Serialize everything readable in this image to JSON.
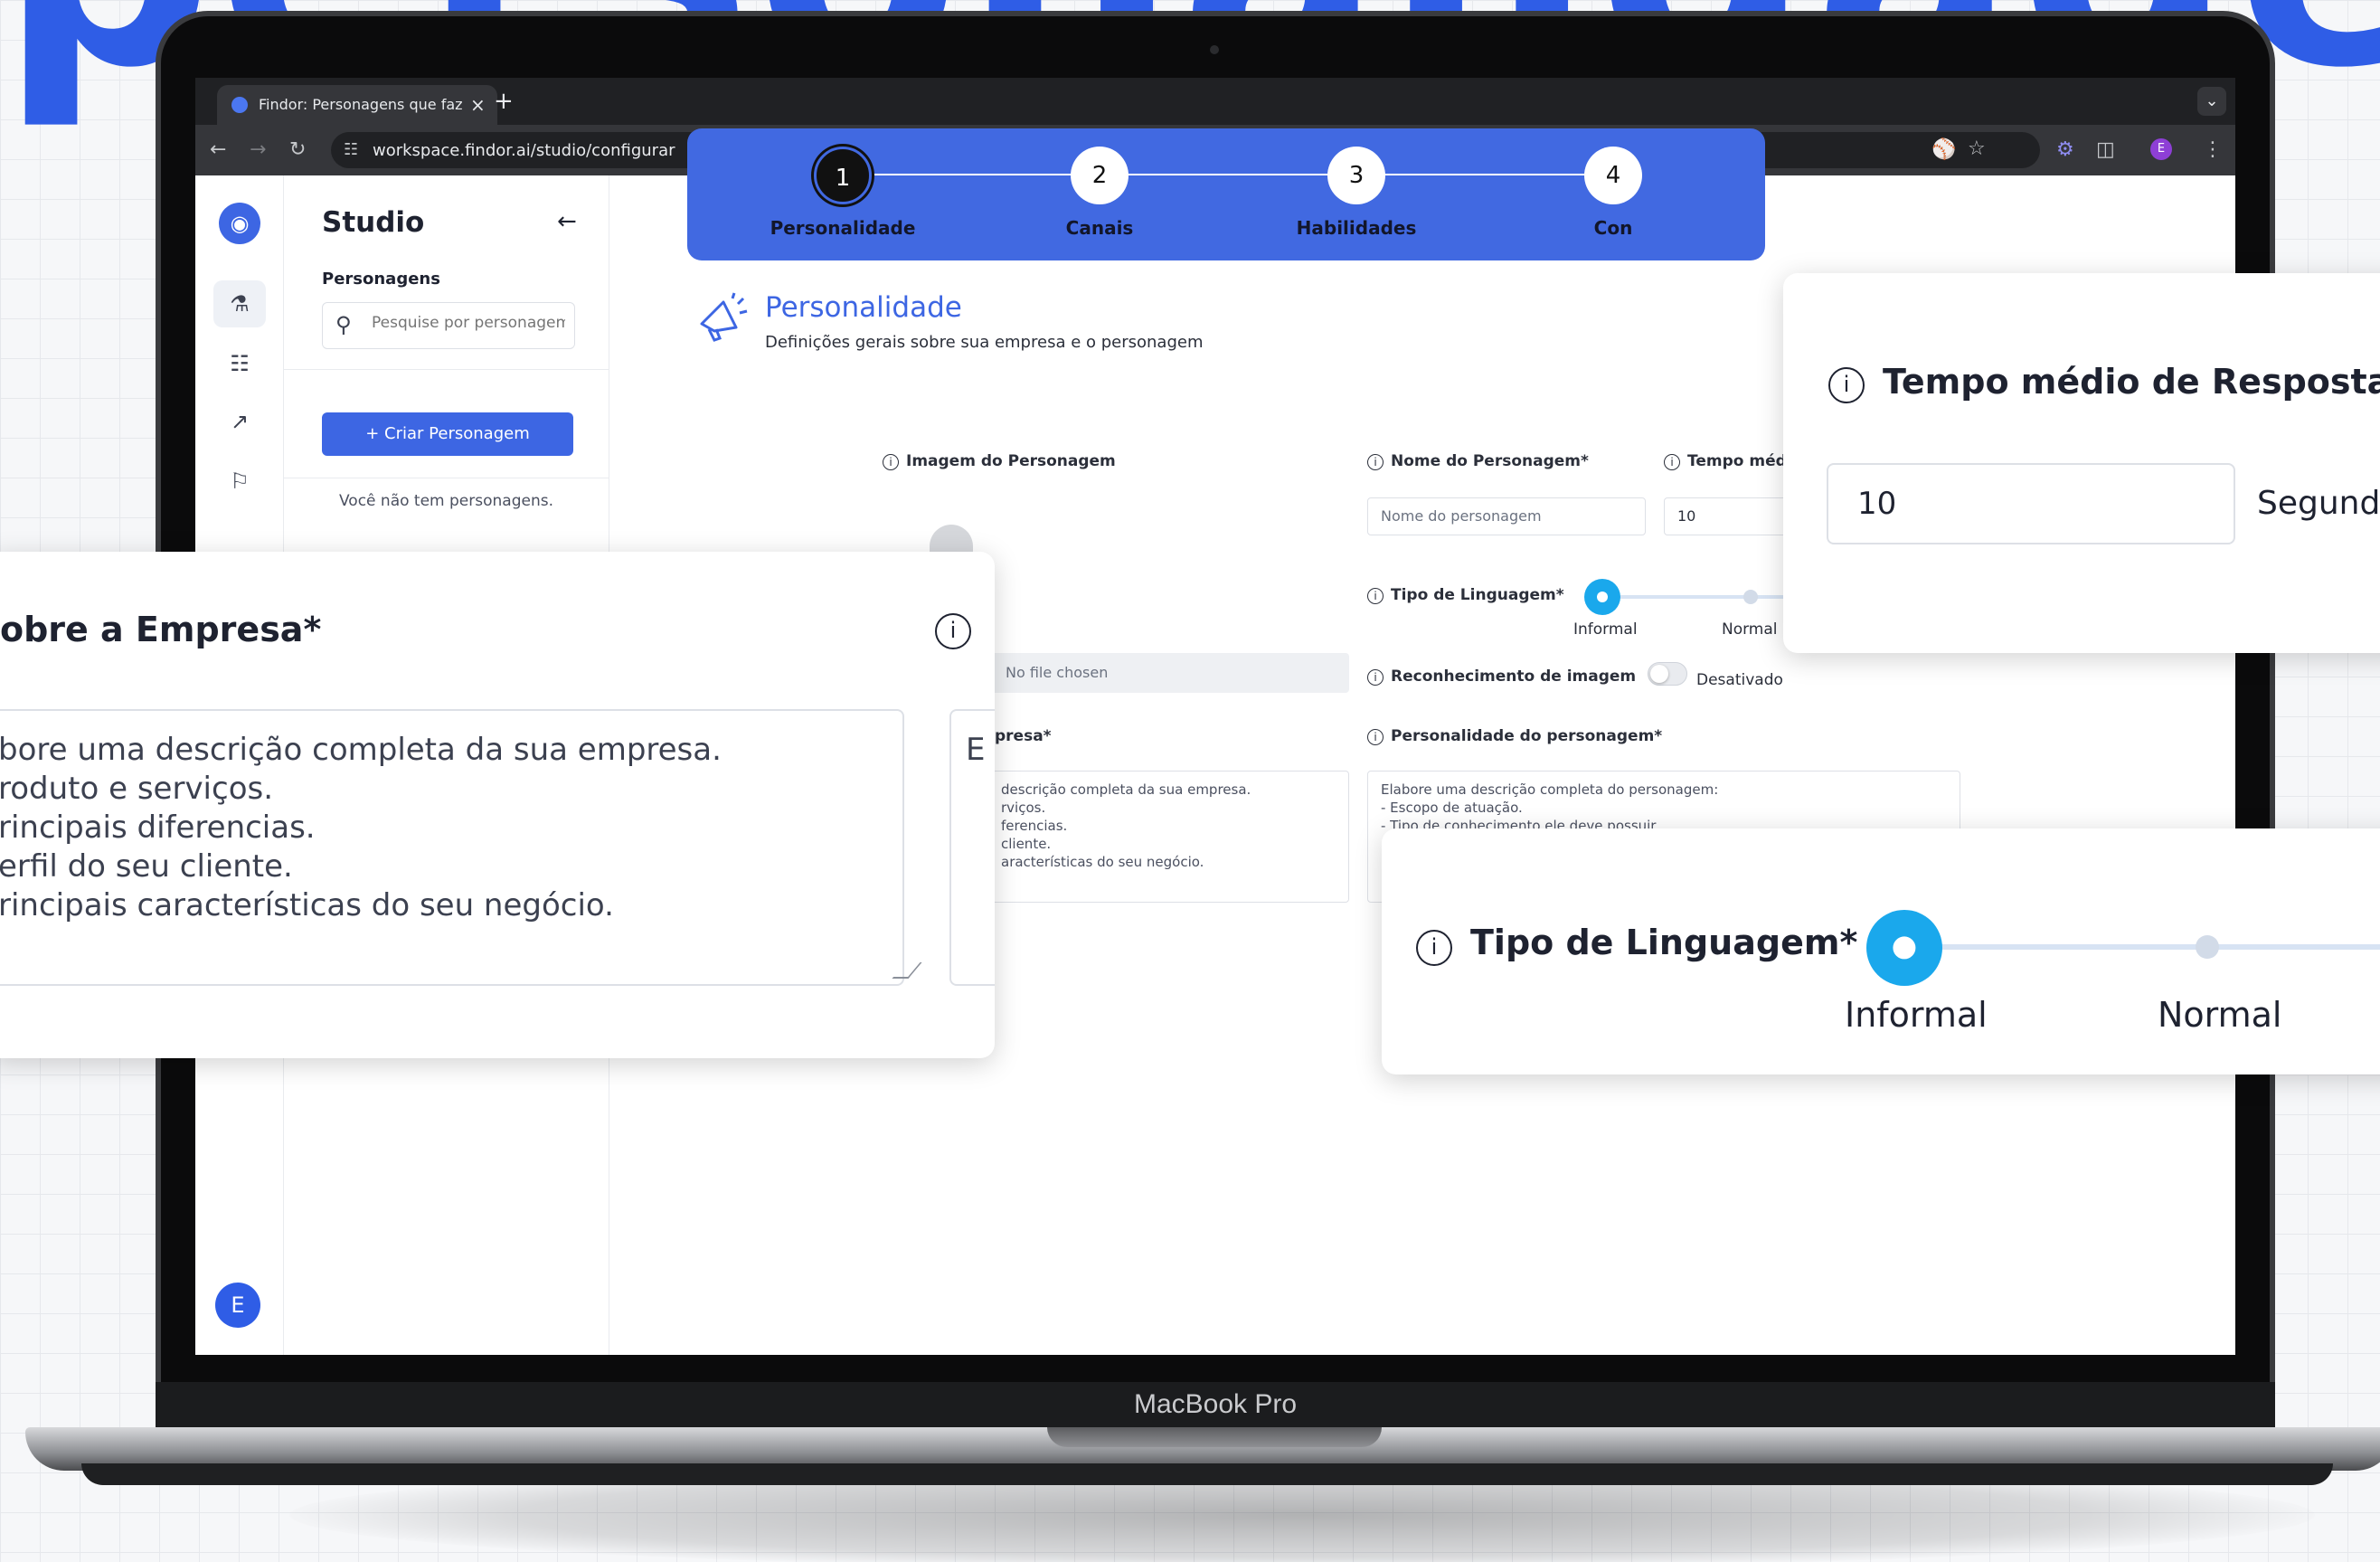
{
  "headline": "personalidade",
  "laptop": {
    "brand": "MacBook Pro"
  },
  "browser": {
    "tab_title": "Findor: Personagens que faz",
    "tab_close": "×",
    "new_tab": "+",
    "url": "workspace.findor.ai/studio/configurar",
    "profile_initial": "E"
  },
  "rail": {
    "avatar_initial": "E"
  },
  "sidebar": {
    "title": "Studio",
    "section_label": "Personagens",
    "search_placeholder": "Pesquise por personagem",
    "create_button": "+ Criar Personagem",
    "empty_text": "Você não tem personagens."
  },
  "stepper": {
    "steps": [
      {
        "number": "1",
        "label": "Personalidade"
      },
      {
        "number": "2",
        "label": "Canais"
      },
      {
        "number": "3",
        "label": "Habilidades"
      },
      {
        "number": "4",
        "label": "Con"
      }
    ]
  },
  "section": {
    "title": "Personalidade",
    "subtitle": "Definições gerais sobre sua empresa e o personagem"
  },
  "form": {
    "image_label": "Imagem do Personagem",
    "file_status": "No file chosen",
    "name_label": "Nome do Personagem*",
    "name_placeholder": "Nome do personagem",
    "tempo_label": "Tempo méd",
    "tempo_value": "10",
    "tipo_label": "Tipo de Linguagem*",
    "tipo_options": [
      "Informal",
      "Normal"
    ],
    "tipo_selected": 0,
    "reconhecimento_label": "Reconhecimento de imagem",
    "reconhecimento_status": "Desativado",
    "empresa_label": "presa*",
    "empresa_text": "descrição completa da sua empresa.\nrviços.\nferencias.\ncliente.\naracterísticas do seu negócio.",
    "personalidade_label": "Personalidade do personagem*",
    "personalidade_text": "Elabore uma descrição completa do personagem:\n- Escopo de atuação.\n- Tipo de conhecimento ele deve possuir."
  },
  "zoom_left": {
    "label": "obre a Empresa*",
    "text": "bore uma descrição completa da sua empresa.\nroduto e serviços.\nrincipais diferencias.\nerfil do seu cliente.\nrincipais características do seu negócio.",
    "partial_letter": "E"
  },
  "zoom_right_top": {
    "label": "Tempo médio de Resposta*",
    "value": "10",
    "unit": "Segund"
  },
  "zoom_right_bottom": {
    "label": "Tipo de Linguagem*",
    "options": [
      "Informal",
      "Normal"
    ]
  },
  "colors": {
    "brand_blue": "#4169e1",
    "headline_blue": "#2f5de6",
    "slider_active": "#1aa8ec"
  }
}
